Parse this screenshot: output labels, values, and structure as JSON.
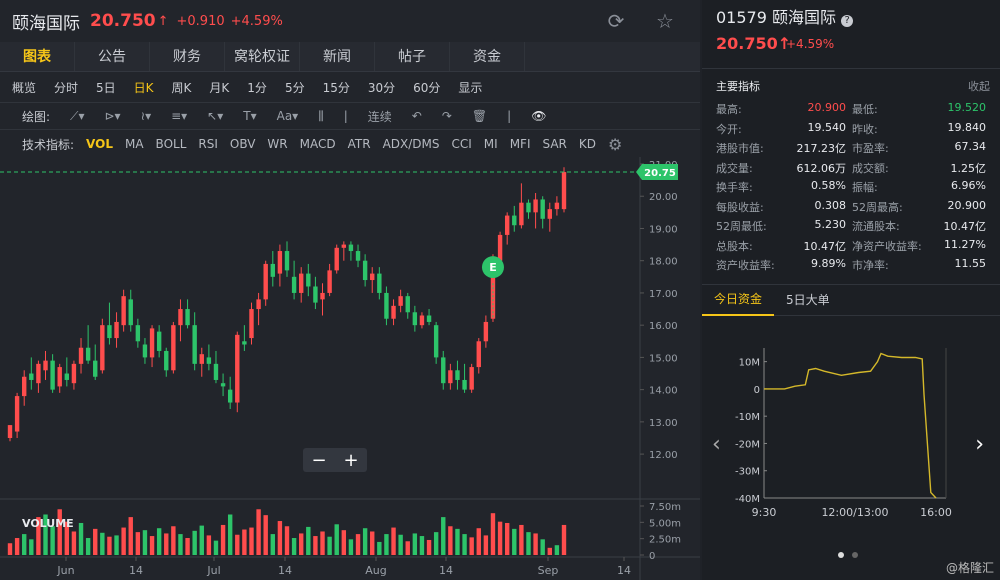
{
  "header": {
    "name": "颐海国际",
    "price": "20.750",
    "arrow": "↑",
    "change": "+0.910",
    "change_pct": "+4.59%",
    "refresh_icon": "refresh-icon",
    "star_icon": "star-icon"
  },
  "tabs": [
    "图表",
    "公告",
    "财务",
    "窝轮权证",
    "新闻",
    "帖子",
    "资金"
  ],
  "periods": [
    "概览",
    "分时",
    "5日",
    "日K",
    "周K",
    "月K",
    "1分",
    "5分",
    "15分",
    "30分",
    "60分",
    "显示"
  ],
  "active_period": "日K",
  "draw": {
    "label": "绘图:",
    "lianxu": "连续"
  },
  "indicators": {
    "label": "技术指标:",
    "items": [
      "VOL",
      "MA",
      "BOLL",
      "RSI",
      "OBV",
      "WR",
      "MACD",
      "ATR",
      "ADX/DMS",
      "CCI",
      "MI",
      "MFI",
      "SAR",
      "KD"
    ]
  },
  "chart": {
    "current_price_label": "20.75",
    "event_marker": "E",
    "volume_label": "VOLUME",
    "zoom_minus": "−",
    "zoom_plus": "+"
  },
  "chart_data": {
    "type": "candlestick",
    "y_ticks": [
      "21.00",
      "20.00",
      "19.00",
      "18.00",
      "17.00",
      "16.00",
      "15.00",
      "14.00",
      "13.00",
      "12.00"
    ],
    "ylim": [
      11.6,
      21.0
    ],
    "volume_ticks": [
      "7.50m",
      "5.00m",
      "2.50m",
      "0"
    ],
    "x_ticks": [
      "Jun",
      "14",
      "Jul",
      "14",
      "Aug",
      "14",
      "Sep",
      "14"
    ],
    "current_price": 20.75,
    "candles": [
      [
        12.5,
        12.9,
        12.4,
        12.9
      ],
      [
        12.7,
        13.9,
        12.5,
        13.8
      ],
      [
        13.8,
        14.6,
        13.5,
        14.4
      ],
      [
        14.5,
        15.0,
        14.0,
        14.3
      ],
      [
        14.2,
        14.9,
        13.9,
        14.8
      ],
      [
        14.6,
        15.2,
        14.3,
        14.9
      ],
      [
        14.9,
        15.1,
        13.9,
        14.0
      ],
      [
        14.1,
        14.8,
        13.9,
        14.7
      ],
      [
        14.5,
        15.0,
        14.1,
        14.3
      ],
      [
        14.2,
        14.9,
        14.0,
        14.8
      ],
      [
        14.8,
        15.6,
        14.5,
        15.3
      ],
      [
        15.3,
        16.0,
        14.8,
        14.9
      ],
      [
        14.9,
        15.4,
        14.3,
        14.4
      ],
      [
        14.6,
        16.2,
        14.5,
        16.0
      ],
      [
        16.0,
        16.7,
        15.4,
        15.6
      ],
      [
        15.6,
        16.4,
        15.3,
        16.1
      ],
      [
        16.0,
        17.1,
        15.8,
        16.9
      ],
      [
        16.8,
        17.1,
        15.8,
        16.0
      ],
      [
        16.0,
        16.2,
        15.3,
        15.5
      ],
      [
        15.4,
        15.6,
        14.8,
        15.0
      ],
      [
        15.0,
        16.0,
        14.7,
        15.9
      ],
      [
        15.8,
        16.0,
        15.0,
        15.2
      ],
      [
        15.2,
        15.3,
        14.4,
        14.6
      ],
      [
        14.6,
        16.1,
        14.5,
        16.0
      ],
      [
        16.0,
        16.8,
        15.5,
        16.5
      ],
      [
        16.5,
        16.8,
        15.9,
        16.0
      ],
      [
        16.0,
        16.4,
        14.6,
        14.8
      ],
      [
        14.8,
        15.3,
        14.4,
        15.1
      ],
      [
        15.0,
        15.4,
        14.6,
        14.8
      ],
      [
        14.8,
        15.2,
        14.2,
        14.3
      ],
      [
        14.2,
        14.5,
        13.8,
        14.1
      ],
      [
        14.0,
        14.4,
        13.4,
        13.6
      ],
      [
        13.6,
        15.8,
        13.3,
        15.7
      ],
      [
        15.5,
        16.0,
        15.2,
        15.4
      ],
      [
        15.6,
        16.7,
        15.4,
        16.5
      ],
      [
        16.5,
        17.0,
        16.0,
        16.8
      ],
      [
        16.8,
        18.0,
        16.6,
        17.9
      ],
      [
        17.9,
        18.3,
        17.2,
        17.5
      ],
      [
        17.6,
        18.5,
        17.2,
        18.3
      ],
      [
        18.3,
        18.6,
        17.5,
        17.7
      ],
      [
        17.5,
        18.0,
        16.8,
        17.0
      ],
      [
        17.0,
        17.8,
        16.7,
        17.6
      ],
      [
        17.6,
        17.9,
        16.9,
        17.2
      ],
      [
        17.2,
        17.5,
        16.5,
        16.7
      ],
      [
        16.8,
        17.3,
        16.3,
        17.0
      ],
      [
        17.0,
        17.9,
        16.9,
        17.7
      ],
      [
        17.7,
        18.5,
        17.6,
        18.4
      ],
      [
        18.4,
        18.6,
        18.0,
        18.5
      ],
      [
        18.5,
        18.6,
        18.0,
        18.3
      ],
      [
        18.3,
        18.5,
        17.8,
        18.0
      ],
      [
        18.0,
        18.2,
        17.2,
        17.4
      ],
      [
        17.4,
        17.8,
        17.0,
        17.6
      ],
      [
        17.6,
        17.8,
        16.8,
        17.0
      ],
      [
        17.0,
        17.2,
        16.0,
        16.2
      ],
      [
        16.2,
        16.8,
        16.0,
        16.6
      ],
      [
        16.6,
        17.1,
        16.4,
        16.9
      ],
      [
        16.9,
        17.0,
        16.2,
        16.4
      ],
      [
        16.4,
        16.6,
        15.8,
        16.0
      ],
      [
        16.0,
        16.4,
        15.9,
        16.3
      ],
      [
        16.3,
        16.5,
        16.0,
        16.1
      ],
      [
        16.0,
        16.1,
        14.8,
        15.0
      ],
      [
        15.0,
        15.2,
        14.0,
        14.2
      ],
      [
        14.2,
        14.8,
        14.0,
        14.6
      ],
      [
        14.6,
        14.9,
        14.0,
        14.3
      ],
      [
        14.3,
        14.8,
        13.9,
        14.0
      ],
      [
        14.0,
        14.8,
        13.9,
        14.7
      ],
      [
        14.7,
        15.6,
        14.5,
        15.5
      ],
      [
        15.5,
        16.3,
        15.3,
        16.1
      ],
      [
        16.2,
        18.2,
        16.1,
        18.0
      ],
      [
        18.0,
        18.9,
        17.8,
        18.8
      ],
      [
        18.8,
        19.5,
        18.5,
        19.4
      ],
      [
        19.4,
        19.7,
        18.9,
        19.1
      ],
      [
        19.1,
        20.4,
        19.0,
        19.8
      ],
      [
        19.8,
        19.9,
        19.3,
        19.5
      ],
      [
        19.5,
        20.1,
        19.0,
        19.9
      ],
      [
        19.9,
        20.0,
        19.0,
        19.3
      ],
      [
        19.3,
        19.8,
        18.9,
        19.6
      ],
      [
        19.6,
        20.0,
        19.4,
        19.8
      ],
      [
        19.6,
        20.9,
        19.5,
        20.75
      ]
    ],
    "volumes": [
      [
        1.8,
        1
      ],
      [
        2.6,
        1
      ],
      [
        3.2,
        0
      ],
      [
        2.4,
        0
      ],
      [
        5.8,
        1
      ],
      [
        6.2,
        0
      ],
      [
        4.4,
        0
      ],
      [
        7.0,
        1
      ],
      [
        5.1,
        1
      ],
      [
        3.6,
        1
      ],
      [
        4.9,
        0
      ],
      [
        2.6,
        0
      ],
      [
        4.0,
        1
      ],
      [
        3.4,
        0
      ],
      [
        2.8,
        1
      ],
      [
        3.0,
        0
      ],
      [
        4.2,
        1
      ],
      [
        5.8,
        1
      ],
      [
        3.5,
        1
      ],
      [
        3.8,
        0
      ],
      [
        2.9,
        1
      ],
      [
        4.1,
        0
      ],
      [
        3.3,
        1
      ],
      [
        4.4,
        1
      ],
      [
        3.2,
        0
      ],
      [
        2.6,
        1
      ],
      [
        3.7,
        0
      ],
      [
        4.5,
        0
      ],
      [
        3.0,
        1
      ],
      [
        2.2,
        0
      ],
      [
        4.6,
        1
      ],
      [
        6.2,
        0
      ],
      [
        3.1,
        1
      ],
      [
        3.9,
        1
      ],
      [
        4.2,
        1
      ],
      [
        7.0,
        1
      ],
      [
        6.1,
        1
      ],
      [
        3.2,
        0
      ],
      [
        5.2,
        1
      ],
      [
        4.4,
        1
      ],
      [
        2.6,
        0
      ],
      [
        3.3,
        1
      ],
      [
        4.3,
        0
      ],
      [
        2.9,
        1
      ],
      [
        3.6,
        1
      ],
      [
        2.8,
        0
      ],
      [
        4.7,
        0
      ],
      [
        3.8,
        1
      ],
      [
        2.4,
        0
      ],
      [
        3.2,
        1
      ],
      [
        4.1,
        0
      ],
      [
        3.6,
        1
      ],
      [
        2.0,
        0
      ],
      [
        3.2,
        0
      ],
      [
        4.2,
        1
      ],
      [
        3.1,
        0
      ],
      [
        2.1,
        1
      ],
      [
        3.3,
        0
      ],
      [
        2.9,
        0
      ],
      [
        2.3,
        1
      ],
      [
        3.5,
        0
      ],
      [
        5.8,
        0
      ],
      [
        4.4,
        1
      ],
      [
        4.0,
        0
      ],
      [
        3.2,
        0
      ],
      [
        2.7,
        1
      ],
      [
        4.1,
        1
      ],
      [
        3.0,
        1
      ],
      [
        6.4,
        1
      ],
      [
        5.1,
        1
      ],
      [
        4.9,
        1
      ],
      [
        4.0,
        0
      ],
      [
        4.6,
        1
      ],
      [
        3.5,
        0
      ],
      [
        3.3,
        1
      ],
      [
        2.4,
        0
      ],
      [
        1.1,
        1
      ],
      [
        1.5,
        0
      ],
      [
        4.6,
        1
      ]
    ]
  },
  "right": {
    "code_name": "01579 颐海国际",
    "help_icon": "help-icon",
    "price": "20.750↑",
    "change_pct": "+4.59%",
    "metrics_title": "主要指标",
    "collapse": "收起",
    "metrics_left": [
      [
        "最高:",
        "20.900"
      ],
      [
        "今开:",
        "19.540"
      ],
      [
        "港股市值:",
        "217.23亿"
      ],
      [
        "成交量:",
        "612.06万"
      ],
      [
        "换手率:",
        "0.58%"
      ],
      [
        "每股收益:",
        "0.308"
      ],
      [
        "52周最低:",
        "5.230"
      ],
      [
        "总股本:",
        "10.47亿"
      ],
      [
        "资产收益率:",
        "9.89%"
      ]
    ],
    "metrics_right": [
      [
        "最低:",
        "19.520"
      ],
      [
        "昨收:",
        "19.840"
      ],
      [
        "市盈率:",
        "67.34"
      ],
      [
        "成交额:",
        "1.25亿"
      ],
      [
        "振幅:",
        "6.96%"
      ],
      [
        "52周最高:",
        "20.900"
      ],
      [
        "流通股本:",
        "10.47亿"
      ],
      [
        "净资产收益率:",
        "11.27%"
      ],
      [
        "市净率:",
        "11.55"
      ]
    ],
    "money_tabs": [
      "今日资金",
      "5日大单"
    ],
    "flow_y": [
      "10M",
      "0",
      "-10M",
      "-20M",
      "-30M",
      "-40M"
    ],
    "flow_x": [
      "9:30",
      "12:00/13:00",
      "16:00"
    ],
    "watermark": "@格隆汇"
  }
}
